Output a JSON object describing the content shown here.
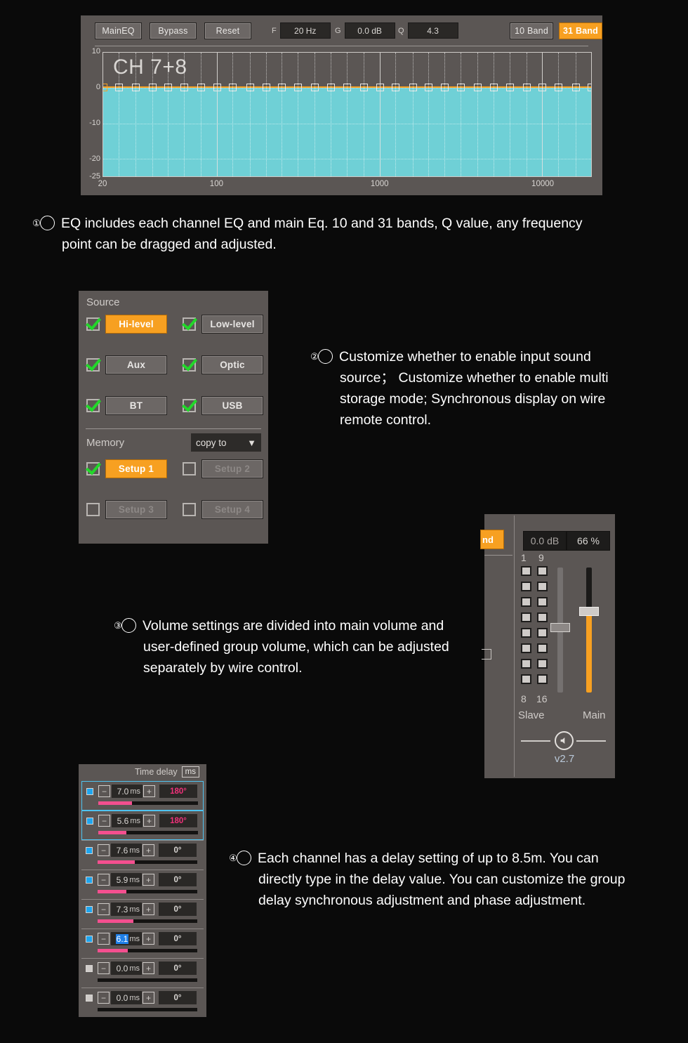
{
  "eq": {
    "buttons": {
      "maineq": "MainEQ",
      "bypass": "Bypass",
      "reset": "Reset",
      "band10": "10 Band",
      "band31": "31 Band"
    },
    "fields": {
      "f_label": "F",
      "f_value": "20 Hz",
      "g_label": "G",
      "g_value": "0.0 dB",
      "q_label": "Q",
      "q_value": "4.3"
    },
    "graph_title": "CH 7+8"
  },
  "chart_data": {
    "type": "line",
    "title": "CH 7+8",
    "xlabel": "",
    "ylabel": "",
    "xscale": "log",
    "xlim": [
      20,
      20000
    ],
    "ylim": [
      -25,
      10
    ],
    "ytick_labels": [
      "10",
      "0",
      "-10",
      "-20",
      "-25"
    ],
    "ytick_values": [
      10,
      0,
      -10,
      -20,
      -25
    ],
    "xtick_labels": [
      "20",
      "100",
      "1000",
      "10000"
    ],
    "xtick_values": [
      20,
      100,
      1000,
      10000
    ],
    "grid": true,
    "series": [
      {
        "name": "EQ curve",
        "color": "#f7a021",
        "fill_color": "#6fd0d6",
        "x": [
          20,
          25,
          31.5,
          40,
          50,
          63,
          80,
          100,
          125,
          160,
          200,
          250,
          315,
          400,
          500,
          630,
          800,
          1000,
          1250,
          1600,
          2000,
          2500,
          3150,
          4000,
          5000,
          6300,
          8000,
          10000,
          12500,
          16000,
          20000
        ],
        "y": [
          0,
          0,
          0,
          0,
          0,
          0,
          0,
          0,
          0,
          0,
          0,
          0,
          0,
          0,
          0,
          0,
          0,
          0,
          0,
          0,
          0,
          0,
          0,
          0,
          0,
          0,
          0,
          0,
          0,
          0,
          0
        ]
      }
    ],
    "selected_node_index": 0,
    "band_count": 31
  },
  "captions": [
    {
      "num": "①",
      "text": "EQ includes each channel EQ and main Eq.  10 and 31 bands, Q value, any frequency point can be dragged and adjusted."
    },
    {
      "num": "②",
      "text": "Customize whether to enable input sound source；  Customize whether to enable multi storage mode; Synchronous display on wire remote control."
    },
    {
      "num": "③",
      "text": "Volume settings are divided into main volume and user-defined group volume, which can be adjusted separately by wire control."
    },
    {
      "num": "④",
      "text": "Each channel has a delay setting of up to 8.5m. You can directly type in the delay value. You can customize the group delay synchronous adjustment and phase adjustment."
    }
  ],
  "source": {
    "title": "Source",
    "items": [
      {
        "label": "Hi-level",
        "checked": true,
        "active": true
      },
      {
        "label": "Low-level",
        "checked": true,
        "active": false
      },
      {
        "label": "Aux",
        "checked": true,
        "active": false
      },
      {
        "label": "Optic",
        "checked": true,
        "active": false
      },
      {
        "label": "BT",
        "checked": true,
        "active": false
      },
      {
        "label": "USB",
        "checked": true,
        "active": false
      }
    ]
  },
  "memory": {
    "title": "Memory",
    "copy_to_label": "copy to",
    "caret": "▼",
    "items": [
      {
        "label": "Setup 1",
        "checked": true,
        "active": true,
        "disabled": false
      },
      {
        "label": "Setup 2",
        "checked": false,
        "active": false,
        "disabled": true
      },
      {
        "label": "Setup 3",
        "checked": false,
        "active": false,
        "disabled": true
      },
      {
        "label": "Setup 4",
        "checked": false,
        "active": false,
        "disabled": true
      }
    ]
  },
  "volume": {
    "band_chip": "nd",
    "db_value": "0.0 dB",
    "percent_value": "66 %",
    "grid_top_left": "1",
    "grid_top_right": "9",
    "grid_bottom_left": "8",
    "grid_bottom_right": "16",
    "slave_label": "Slave",
    "main_label": "Main",
    "version": "v2.7",
    "speaker_icon": "🔊",
    "main_level_percent": 66,
    "slave_level_percent": 45
  },
  "time_delay": {
    "title": "Time delay",
    "unit": "ms",
    "minus": "−",
    "plus": "+",
    "rows": [
      {
        "led": true,
        "value": "7.0",
        "unit": "ms",
        "phase": "180°",
        "phase180": true,
        "bar": 34,
        "selected": true,
        "editing": false
      },
      {
        "led": true,
        "value": "5.6",
        "unit": "ms",
        "phase": "180°",
        "phase180": true,
        "bar": 28,
        "selected": true,
        "editing": false
      },
      {
        "led": true,
        "value": "7.6",
        "unit": "ms",
        "phase": "0°",
        "phase180": false,
        "bar": 37,
        "selected": false,
        "editing": false
      },
      {
        "led": true,
        "value": "5.9",
        "unit": "ms",
        "phase": "0°",
        "phase180": false,
        "bar": 29,
        "selected": false,
        "editing": false
      },
      {
        "led": true,
        "value": "7.3",
        "unit": "ms",
        "phase": "0°",
        "phase180": false,
        "bar": 36,
        "selected": false,
        "editing": false
      },
      {
        "led": true,
        "value": "6.1",
        "unit": "ms",
        "phase": "0°",
        "phase180": false,
        "bar": 30,
        "selected": false,
        "editing": true
      },
      {
        "led": false,
        "value": "0.0",
        "unit": "ms",
        "phase": "0°",
        "phase180": false,
        "bar": 0,
        "selected": false,
        "editing": false
      },
      {
        "led": false,
        "value": "0.0",
        "unit": "ms",
        "phase": "0°",
        "phase180": false,
        "bar": 0,
        "selected": false,
        "editing": false
      }
    ]
  }
}
